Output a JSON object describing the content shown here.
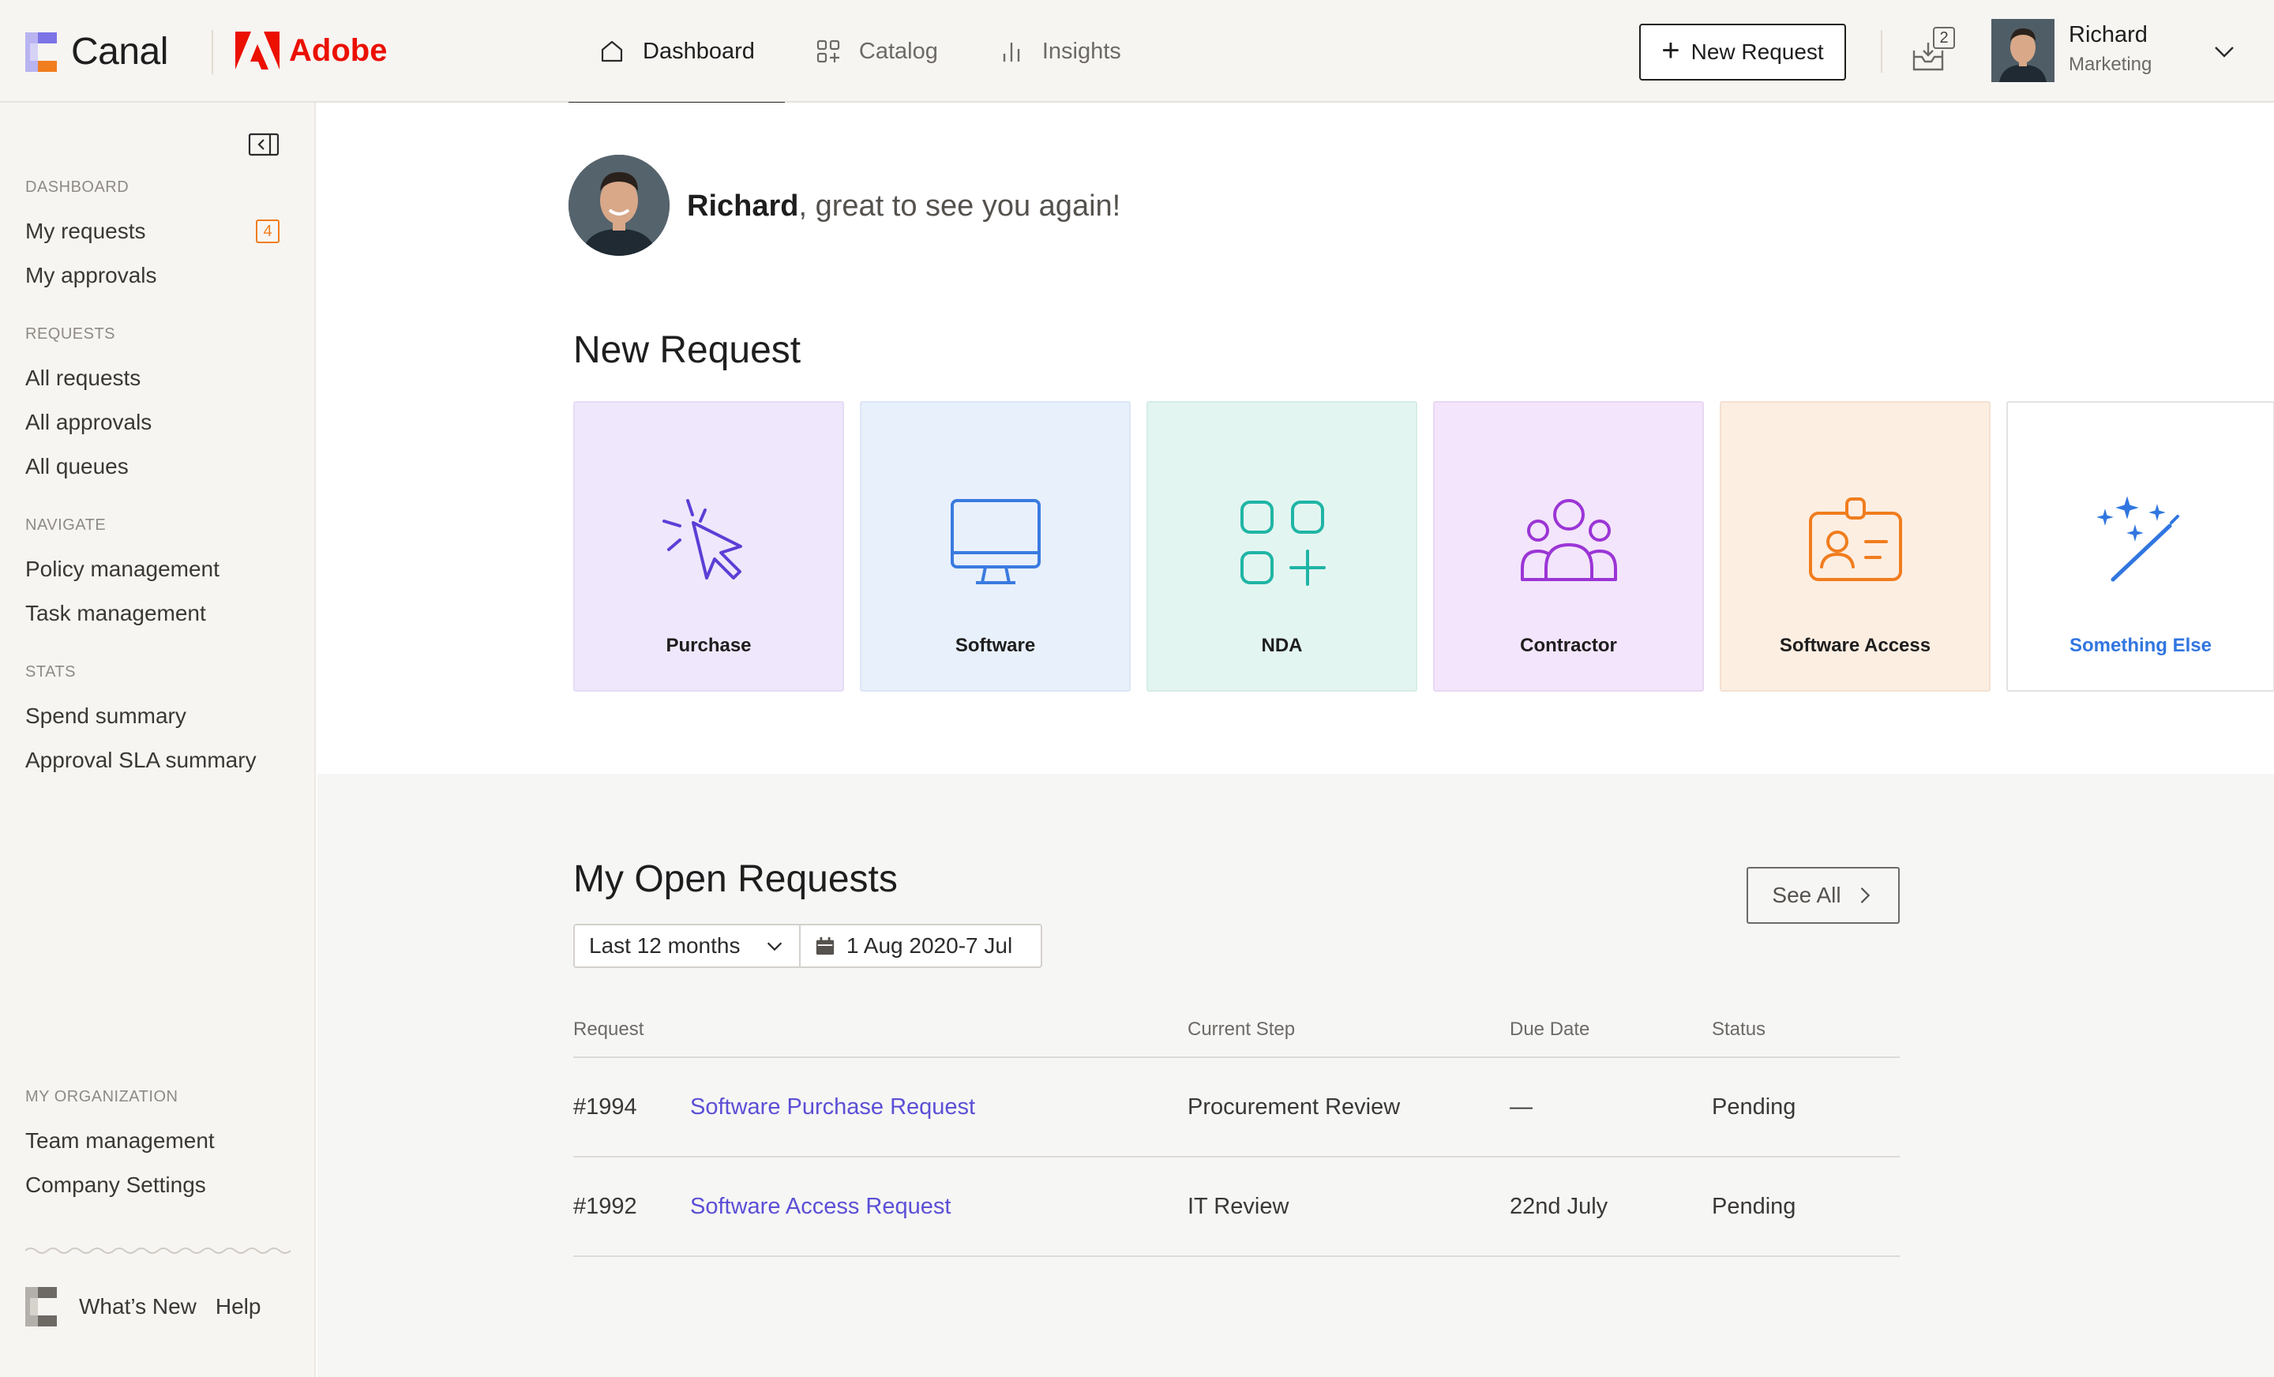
{
  "brand": {
    "app_name": "Canal",
    "partner_name": "Adobe"
  },
  "nav": {
    "tabs": [
      {
        "label": "Dashboard",
        "icon": "home-icon",
        "active": true
      },
      {
        "label": "Catalog",
        "icon": "grid-icon",
        "active": false
      },
      {
        "label": "Insights",
        "icon": "bar-chart-icon",
        "active": false
      }
    ]
  },
  "header": {
    "new_request_label": "New Request",
    "inbox_count": "2",
    "user_name": "Richard",
    "user_department": "Marketing"
  },
  "sidebar": {
    "sections": [
      {
        "heading": "DASHBOARD",
        "items": [
          {
            "label": "My requests",
            "badge": "4"
          },
          {
            "label": "My approvals"
          }
        ]
      },
      {
        "heading": "REQUESTS",
        "items": [
          {
            "label": "All requests"
          },
          {
            "label": "All approvals"
          },
          {
            "label": "All queues"
          }
        ]
      },
      {
        "heading": "NAVIGATE",
        "items": [
          {
            "label": "Policy management"
          },
          {
            "label": "Task management"
          }
        ]
      },
      {
        "heading": "STATS",
        "items": [
          {
            "label": "Spend summary"
          },
          {
            "label": "Approval SLA summary"
          }
        ]
      },
      {
        "heading": "MY ORGANIZATION",
        "items": [
          {
            "label": "Team management"
          },
          {
            "label": "Company Settings"
          }
        ]
      }
    ],
    "footer": {
      "whats_new": "What’s New",
      "help": "Help"
    }
  },
  "greeting": {
    "name": "Richard",
    "message": ", great to see you again!"
  },
  "new_request": {
    "title": "New Request",
    "cards": [
      {
        "label": "Purchase",
        "icon": "cursor-click-icon",
        "color": "#5b3fd6"
      },
      {
        "label": "Software",
        "icon": "monitor-icon",
        "color": "#3a7be0"
      },
      {
        "label": "NDA",
        "icon": "apps-add-icon",
        "color": "#1fb5a5"
      },
      {
        "label": "Contractor",
        "icon": "people-icon",
        "color": "#9b35d6"
      },
      {
        "label": "Software Access",
        "icon": "id-badge-icon",
        "color": "#f07d1e"
      },
      {
        "label": "Something Else",
        "icon": "magic-wand-icon",
        "color": "#3176e0"
      }
    ]
  },
  "open_requests": {
    "title": "My Open Requests",
    "see_all_label": "See All",
    "period_select": "Last 12 months",
    "date_range": "1 Aug 2020-7 Jul",
    "columns": {
      "request": "Request",
      "current_step": "Current Step",
      "due_date": "Due Date",
      "status": "Status"
    },
    "rows": [
      {
        "id": "#1994",
        "name": "Software Purchase Request",
        "step": "Procurement Review",
        "due": "—",
        "status": "Pending"
      },
      {
        "id": "#1992",
        "name": "Software Access Request",
        "step": "IT Review",
        "due": "22nd July",
        "status": "Pending"
      }
    ]
  }
}
